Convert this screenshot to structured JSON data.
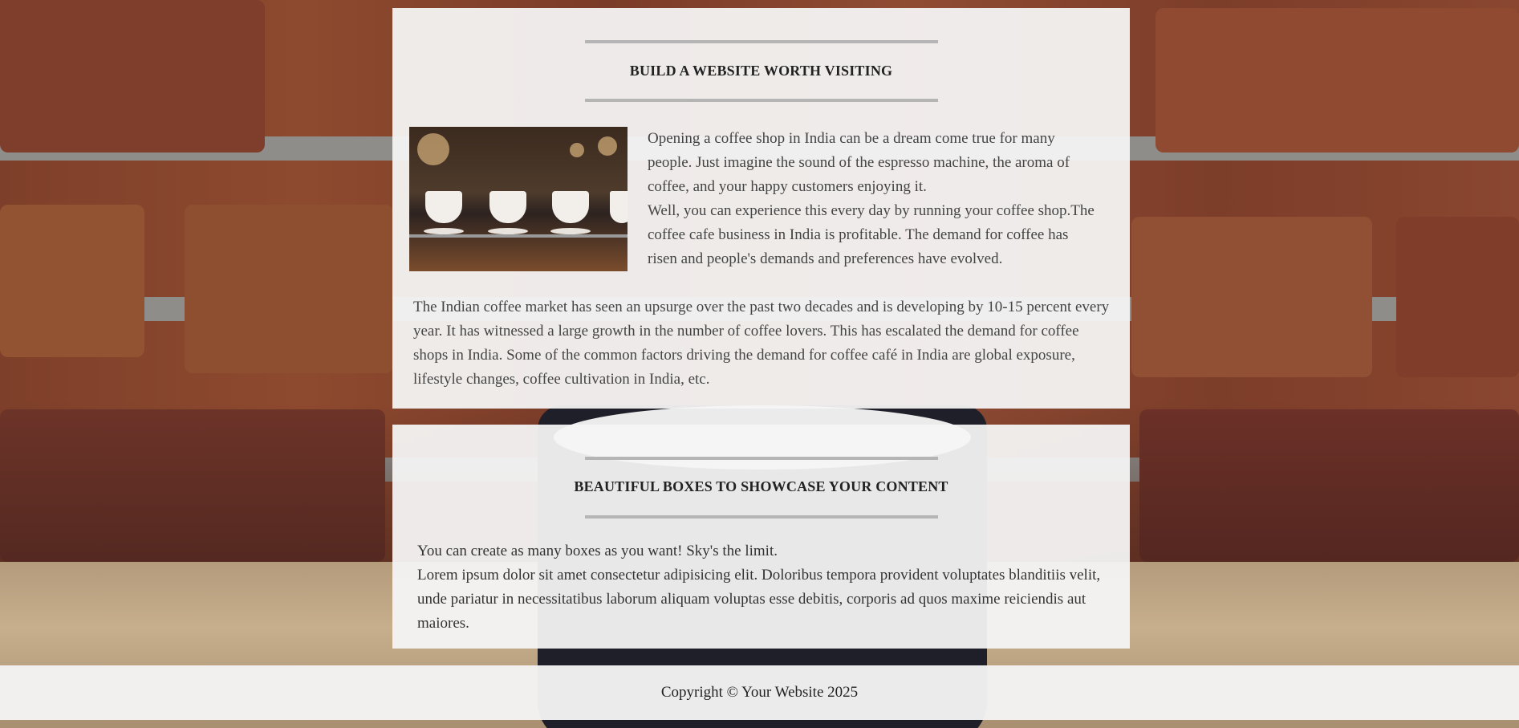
{
  "section_1": {
    "heading": "BUILD A WEBSITE WORTH VISITING",
    "intro_line_1": "Opening a coffee shop in India can be a dream come true for many people. Just imagine the sound of the espresso machine, the aroma of coffee, and your happy customers enjoying it.",
    "intro_line_2": "Well, you can experience this every day by running your coffee shop.The coffee cafe business in India is profitable. The demand for coffee has risen and people's demands and preferences have evolved.",
    "market_paragraph": "The Indian coffee market has seen an upsurge over the past two decades and is developing by 10-15 percent every year. It has witnessed a large growth in the number of coffee lovers. This has escalated the demand for coffee shops in India. Some of the common factors driving the demand for coffee café in India are global exposure, lifestyle changes, coffee cultivation in India, etc."
  },
  "section_2": {
    "heading": "BEAUTIFUL BOXES TO SHOWCASE YOUR CONTENT",
    "line_1": "You can create as many boxes as you want! Sky's the limit.",
    "line_2": "Lorem ipsum dolor sit amet consectetur adipisicing elit. Doloribus tempora provident voluptates blanditiis velit, unde pariatur in necessitatibus laborum aliquam voluptas esse debitis, corporis ad quos maxime reiciendis aut maiores."
  },
  "footer": {
    "copyright": "Copyright © Your Website 2025"
  }
}
